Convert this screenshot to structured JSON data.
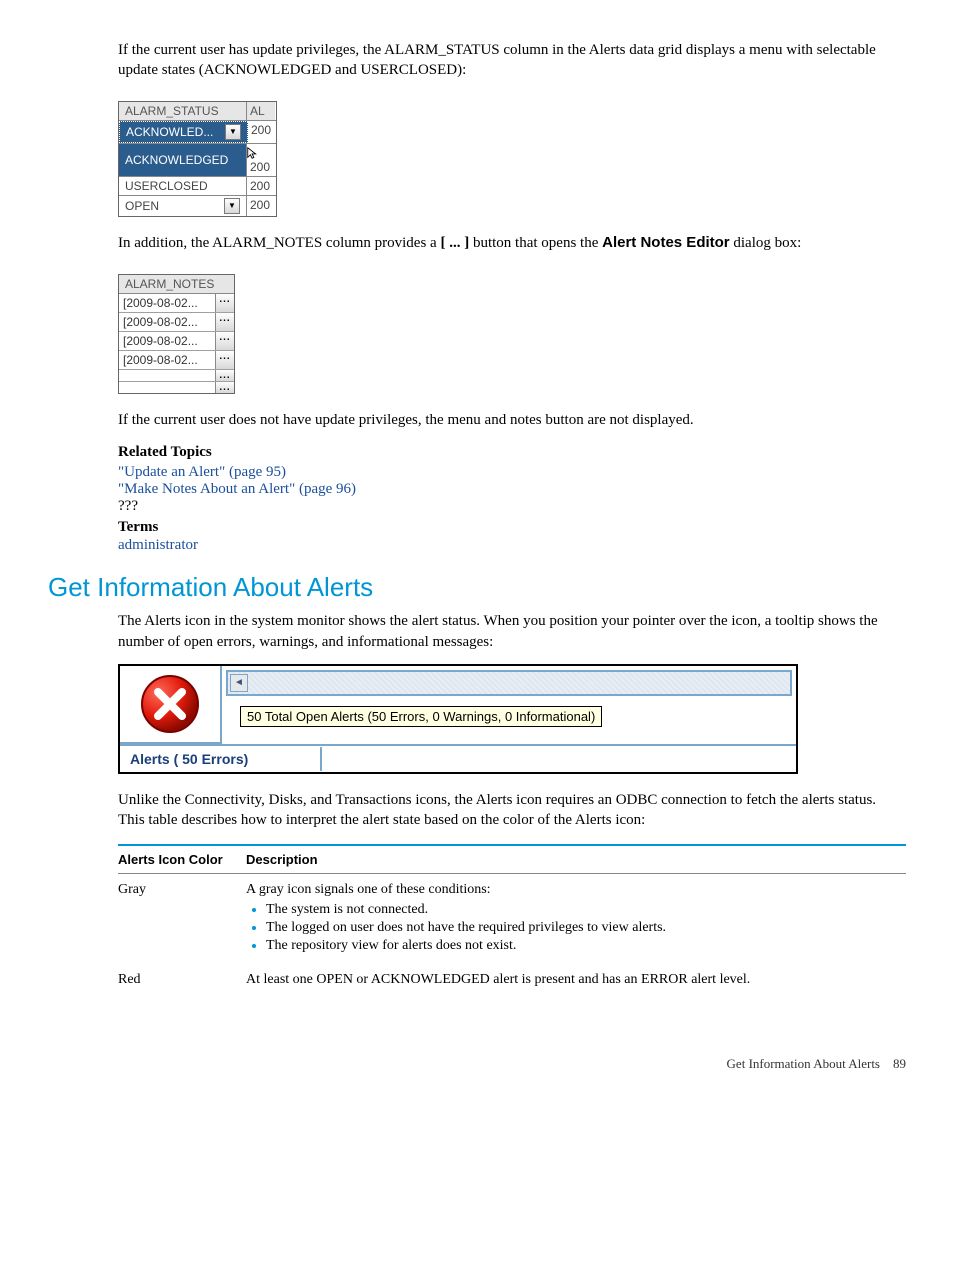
{
  "intro": {
    "p1a": "If the current user has update privileges, the ALARM_STATUS column in the Alerts data grid displays a menu with selectable update states (ACKNOWLEDGED and USERCLOSED):"
  },
  "status_table": {
    "header_a": "ALARM_STATUS",
    "header_b": "AL",
    "rows": [
      {
        "label": "ACKNOWLED...",
        "val": "200",
        "has_dd": true
      },
      {
        "label": "ACKNOWLEDGED",
        "val": "200",
        "has_cursor": true
      },
      {
        "label": "USERCLOSED",
        "val": "200"
      },
      {
        "label": "OPEN",
        "val": "200",
        "has_dd": true
      }
    ]
  },
  "notes_intro_a": "In addition, the ALARM_NOTES column provides a ",
  "notes_intro_b": "[ ... ]",
  "notes_intro_c": " button that opens the ",
  "notes_intro_d": "Alert Notes Editor",
  "notes_intro_e": " dialog box:",
  "notes_table": {
    "header": "ALARM_NOTES",
    "rows": [
      "[2009-08-02...",
      "[2009-08-02...",
      "[2009-08-02...",
      "[2009-08-02...",
      "",
      ""
    ],
    "btn": "..."
  },
  "no_privs": "If the current user does not have update privileges, the menu and notes button are not displayed.",
  "related": {
    "heading": "Related Topics",
    "links": [
      "\"Update an Alert\" (page 95)",
      "\"Make Notes About an Alert\" (page 96)"
    ],
    "unk": "???"
  },
  "terms": {
    "heading": "Terms",
    "link": "administrator"
  },
  "section_title": "Get Information About Alerts",
  "section_intro": "The Alerts icon in the system monitor shows the alert status. When you position your pointer over the icon, a tooltip shows the number of open errors, warnings, and informational messages:",
  "tooltip_text": "50 Total Open Alerts (50 Errors, 0 Warnings, 0 Informational)",
  "alerts_label": "Alerts ( 50 Errors)",
  "after_shot": "Unlike the Connectivity, Disks, and Transactions icons, the Alerts icon requires an ODBC connection to fetch the alerts status. This table describes how to interpret the alert state based on the color of the Alerts icon:",
  "table": {
    "th1": "Alerts Icon Color",
    "th2": "Description",
    "rows": [
      {
        "color": "Gray",
        "desc": "A gray icon signals one of these conditions:",
        "bullets": [
          "The system is not connected.",
          "The logged on user does not have the required privileges to view alerts.",
          "The repository view for alerts does not exist."
        ]
      },
      {
        "color": "Red",
        "desc": "At least one OPEN or ACKNOWLEDGED alert is present and has an ERROR alert level."
      }
    ]
  },
  "footer_text": "Get Information About Alerts",
  "footer_page": "89"
}
